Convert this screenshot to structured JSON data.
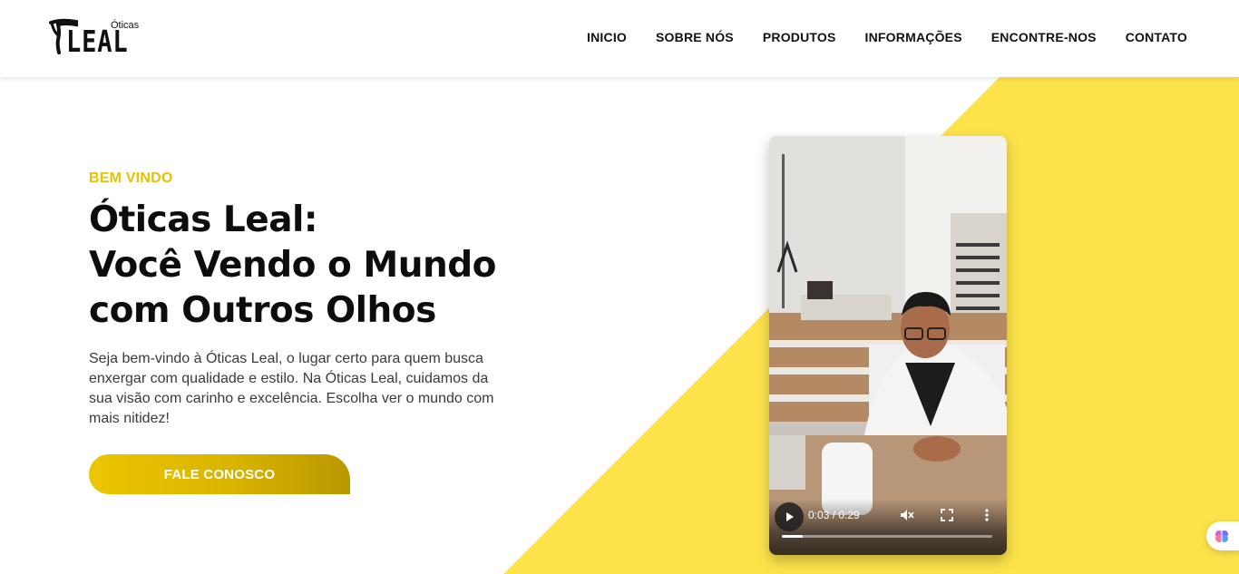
{
  "brand": {
    "logo_small": "Óticas",
    "logo_big": "LEAL"
  },
  "nav": {
    "items": [
      {
        "label": "INICIO"
      },
      {
        "label": "SOBRE NÓS"
      },
      {
        "label": "PRODUTOS"
      },
      {
        "label": "INFORMAÇÕES"
      },
      {
        "label": "ENCONTRE-NOS"
      },
      {
        "label": "CONTATO"
      }
    ]
  },
  "hero": {
    "kicker": "BEM VINDO",
    "title_lines": [
      "Óticas Leal:",
      "Você Vendo o Mundo",
      "com Outros Olhos"
    ],
    "description": "Seja bem-vindo à Óticas Leal, o lugar certo para quem busca enxergar com qualidade e estilo. Na Óticas Leal, cuidamos da sua visão com carinho e excelência. Escolha ver o mundo com mais nitidez!",
    "cta_label": "FALE CONOSCO"
  },
  "video": {
    "time_display": "0:03 / 0:29",
    "progress_fraction": 0.1,
    "play_icon": "play-icon",
    "mute_icon": "volume-muted-icon",
    "fullscreen_icon": "fullscreen-icon",
    "more_icon": "more-vertical-icon"
  },
  "colors": {
    "accent_yellow": "#fce34a",
    "kicker_yellow": "#e6c200",
    "button_gradient_start": "#ecc600",
    "button_gradient_end": "#b99700"
  },
  "widget": {
    "icon": "brain-icon"
  }
}
